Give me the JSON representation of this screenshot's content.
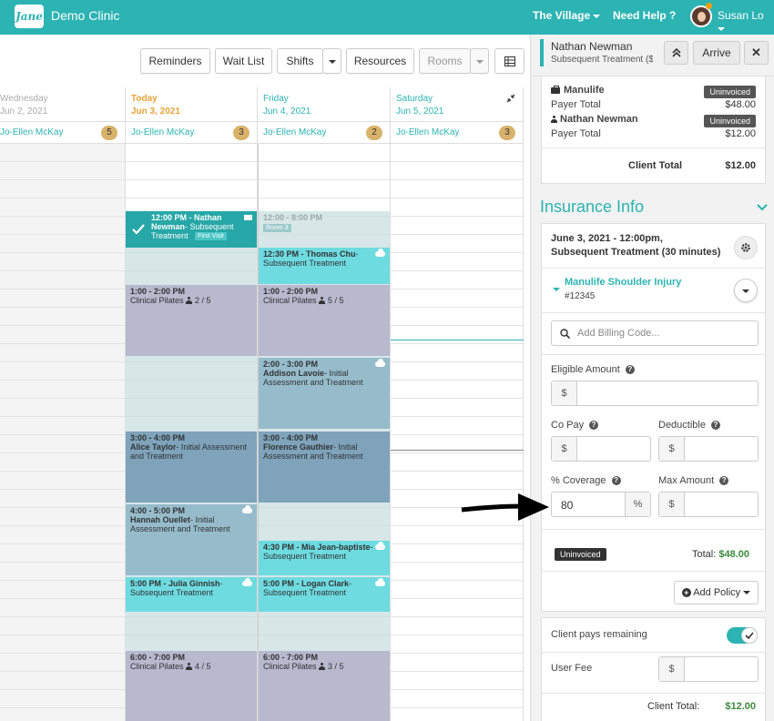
{
  "topbar": {
    "logo_text": "Jane",
    "clinic_name": "Demo Clinic",
    "location": "The Village",
    "help": "Need Help ?",
    "user": "Susan Lo"
  },
  "toolbar": {
    "reminders": "Reminders",
    "wait_list": "Wait List",
    "shifts": "Shifts",
    "resources": "Resources",
    "rooms": "Rooms"
  },
  "columns": [
    {
      "day": "Wednesday",
      "date": "Jun 2, 2021",
      "staff": "Jo-Ellen McKay",
      "count": "5"
    },
    {
      "day": "Today",
      "date": "Jun 3, 2021",
      "staff": "Jo-Ellen McKay",
      "count": "3"
    },
    {
      "day": "Friday",
      "date": "Jun 4, 2021",
      "staff": "Jo-Ellen McKay",
      "count": "2"
    },
    {
      "day": "Saturday",
      "date": "Jun 5, 2021",
      "staff": "Jo-Ellen McKay",
      "count": "3"
    }
  ],
  "appointments": {
    "a1": {
      "time": "12:00 PM - Nathan Newman",
      "desc": "- Subsequent Treatment",
      "tag": "First Visit"
    },
    "a2": {
      "time": "12:00 - 8:00 PM",
      "tag": "Room 3"
    },
    "a3": {
      "time": "12:30 PM - Thomas Chu",
      "desc": "- Subsequent Treatment"
    },
    "a4": {
      "time": "1:00 - 2:00 PM",
      "desc": "Clinical Pilates",
      "count": "2 / 5"
    },
    "a5": {
      "time": "1:00 - 2:00 PM",
      "desc": "Clinical Pilates",
      "count": "5 / 5"
    },
    "a6": {
      "time": "2:00 - 3:00 PM",
      "name": "Addison Lavoie",
      "desc": "- Initial Assessment and Treatment"
    },
    "a7": {
      "time": "3:00 - 4:00 PM",
      "name": "Alice Taylor",
      "desc": "- Initial Assessment and Treatment"
    },
    "a8": {
      "time": "3:00 - 4:00 PM",
      "name": "Florence Gauthier",
      "desc": "- Initial Assessment and Treatment"
    },
    "a9": {
      "time": "4:00 - 5:00 PM",
      "name": "Hannah Ouellet",
      "desc": "- Initial Assessment and Treatment"
    },
    "a10": {
      "time": "4:30 PM - Mia Jean-baptiste",
      "desc": "- Subsequent Treatment"
    },
    "a11": {
      "time": "5:00 PM - Julia Ginnish",
      "desc": "- Subsequent Treatment"
    },
    "a12": {
      "time": "5:00 PM - Logan Clark",
      "desc": "- Subsequent Treatment"
    },
    "a13": {
      "time": "6:00 - 7:00 PM",
      "desc": "Clinical Pilates",
      "count": "4 / 5"
    },
    "a14": {
      "time": "6:00 - 7:00 PM",
      "desc": "Clinical Pilates",
      "count": "3 / 5"
    }
  },
  "panel": {
    "patient_name": "Nathan Newman",
    "patient_sub": "Subsequent Treatment ($",
    "arrive": "Arrive",
    "payer1_name": "Manulife",
    "payer1_status": "Uninvoiced",
    "payer_total_label": "Payer Total",
    "payer1_total": "$48.00",
    "payer2_name": "Nathan Newman",
    "payer2_status": "Uninvoiced",
    "payer2_total": "$12.00",
    "client_total_label": "Client Total",
    "client_total": "$12.00",
    "insurance_heading": "Insurance Info",
    "appt_line1": "June 3, 2021 - 12:00pm,",
    "appt_line2": "Subsequent Treatment (30 minutes)",
    "policy_name": "Manulife Shoulder Injury",
    "policy_number": "#12345",
    "billing_placeholder": "Add Billing Code...",
    "eligible_label": "Eligible Amount",
    "copay_label": "Co Pay",
    "deductible_label": "Deductible",
    "coverage_label": "% Coverage",
    "max_label": "Max Amount",
    "coverage_value": "80",
    "currency": "$",
    "percent": "%",
    "status": "Uninvoiced",
    "total_label": "Total:",
    "total_value": "$48.00",
    "add_policy": "Add Policy",
    "client_pays_label": "Client pays remaining",
    "user_fee_label": "User Fee",
    "client_total_label2": "Client Total:",
    "client_total2": "$12.00"
  },
  "colors": {
    "brand": "#2cb3b3",
    "accent": "#f5a623"
  }
}
